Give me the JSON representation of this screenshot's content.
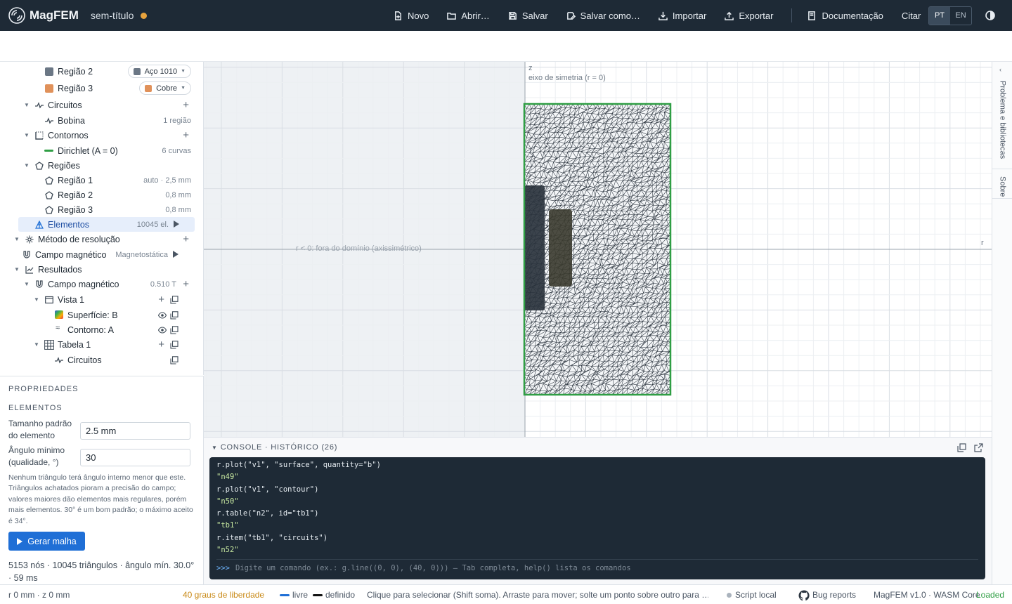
{
  "app": {
    "name": "MagFEM",
    "document_title": "sem-título",
    "accent_color": "#1f6fd6",
    "unsaved_color": "#e8a33d"
  },
  "menu": {
    "new": "Novo",
    "open": "Abrir…",
    "save": "Salvar",
    "save_as": "Salvar como…",
    "import": "Importar",
    "export": "Exportar",
    "docs": "Documentação",
    "cite": "Citar",
    "lang_pt": "PT",
    "lang_en": "EN"
  },
  "tree": {
    "material_rows": [
      {
        "label": "Região 2",
        "color": "#6b7785",
        "material": "Aço 1010",
        "material_color": "#6b7785"
      },
      {
        "label": "Região 3",
        "color": "#e0915a",
        "material": "Cobre",
        "material_color": "#e0915a"
      }
    ],
    "circuits": {
      "label": "Circuitos",
      "child_label": "Bobina",
      "child_meta": "1 região"
    },
    "boundaries": {
      "label": "Contornos",
      "child_label": "Dirichlet (A = 0)",
      "child_meta": "6 curvas",
      "child_color": "#2f9e44"
    },
    "regions": {
      "label": "Regiões",
      "items": [
        {
          "label": "Região 1",
          "meta": "auto · 2,5 mm"
        },
        {
          "label": "Região 2",
          "meta": "0,8 mm"
        },
        {
          "label": "Região 3",
          "meta": "0,8 mm"
        }
      ]
    },
    "elements": {
      "label": "Elementos",
      "meta": "10045 el."
    },
    "solver": {
      "label": "Método de resolução"
    },
    "field": {
      "label": "Campo magnético",
      "meta": "Magnetostática"
    },
    "results": {
      "label": "Resultados",
      "field_label": "Campo magnético",
      "field_meta": "0.510 T",
      "view_label": "Vista 1",
      "surface_label": "Superfície: B",
      "contour_label": "Contorno: A",
      "table_label": "Tabela 1",
      "table_child_label": "Circuitos"
    }
  },
  "properties": {
    "heading": "PROPRIEDADES",
    "section": "ELEMENTOS",
    "size_label": "Tamanho padrão do elemento",
    "size_value": "2.5 mm",
    "angle_label": "Ângulo mínimo (qualidade, °)",
    "angle_value": "30",
    "help": "Nenhum triângulo terá ângulo interno menor que este. Triângulos achatados pioram a precisão do campo; valores maiores dão elementos mais regulares, porém mais elementos. 30° é um bom padrão; o máximo aceito é 34°.",
    "generate_button": "Gerar malha",
    "stats": "5153 nós · 10045 triângulos · ângulo mín. 30.0° · 59 ms"
  },
  "canvas": {
    "z_axis_label": "z",
    "symmetry_label": "eixo de simetria (r = 0)",
    "r_axis_label": "r",
    "negative_zone_label": "r < 0: fora do domínio (axissimétrico)",
    "boundary_color": "#2f9e44",
    "steel_color": "#2a333d",
    "copper_color": "#3a3a2e"
  },
  "right_rail": {
    "tab_problem": "Problema e bibliotecas",
    "tab_about": "Sobre"
  },
  "console": {
    "title": "CONSOLE · HISTÓRICO (26)",
    "lines": [
      {
        "kind": "cmd",
        "text": "r.plot(\"v1\", \"surface\", quantity=\"b\")"
      },
      {
        "kind": "out",
        "text": "\"n49\""
      },
      {
        "kind": "cmd",
        "text": "r.plot(\"v1\", \"contour\")"
      },
      {
        "kind": "out",
        "text": "\"n50\""
      },
      {
        "kind": "cmd",
        "text": "r.table(\"n2\", id=\"tb1\")"
      },
      {
        "kind": "out",
        "text": "\"tb1\""
      },
      {
        "kind": "cmd",
        "text": "r.item(\"tb1\", \"circuits\")"
      },
      {
        "kind": "out",
        "text": "\"n52\""
      }
    ],
    "prompt": ">>>",
    "placeholder": "Digite um comando (ex.: g.line((0, 0), (40, 0))) — Tab completa, help() lista os comandos"
  },
  "status": {
    "coords": "r 0 mm · z 0 mm",
    "dof": "40 graus de liberdade",
    "legend_free": "livre",
    "legend_defined": "definido",
    "hint": "Clique para selecionar (Shift soma). Arraste para mover; solte um ponto sobre outro para …",
    "script": "Script local",
    "bug_reports": "Bug reports",
    "version": "MagFEM v1.0 · WASM Core",
    "core_state": "Loaded"
  }
}
